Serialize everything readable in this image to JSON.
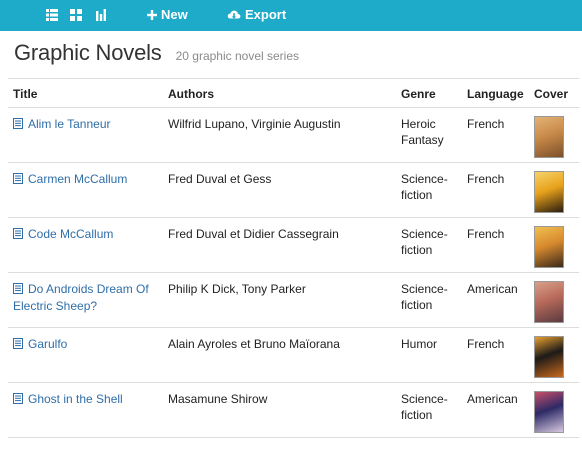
{
  "toolbar": {
    "view_icons": [
      "list-view-icon",
      "grid-view-icon",
      "chart-view-icon"
    ],
    "new_label": "New",
    "export_label": "Export",
    "accent_color": "#1eaac9"
  },
  "header": {
    "title": "Graphic Novels",
    "subtitle": "20 graphic novel series"
  },
  "table": {
    "columns": [
      "Title",
      "Authors",
      "Genre",
      "Language",
      "Cover"
    ],
    "rows": [
      {
        "title": "Alim le Tanneur",
        "authors": "Wilfrid Lupano, Virginie Augustin",
        "genre": "Heroic Fantasy",
        "language": "French",
        "cover_colors": [
          "#c98b4a",
          "#7d4f2a",
          "#e3b277"
        ]
      },
      {
        "title": "Carmen McCallum",
        "authors": "Fred Duval et Gess",
        "genre": "Science-fiction",
        "language": "French",
        "cover_colors": [
          "#e8a21c",
          "#2a1d10",
          "#f5d36a"
        ]
      },
      {
        "title": "Code McCallum",
        "authors": "Fred Duval et Didier Cassegrain",
        "genre": "Science-fiction",
        "language": "French",
        "cover_colors": [
          "#d88a2e",
          "#3b2a1c",
          "#f0c050"
        ]
      },
      {
        "title": "Do Androids Dream Of Electric Sheep?",
        "authors": "Philip K Dick, Tony Parker",
        "genre": "Science-fiction",
        "language": "American",
        "cover_colors": [
          "#b86a5a",
          "#5a3a40",
          "#d9a08a"
        ]
      },
      {
        "title": "Garulfo",
        "authors": "Alain Ayroles et Bruno Maïorana",
        "genre": "Humor",
        "language": "French",
        "cover_colors": [
          "#1c1a18",
          "#c96a1e",
          "#e8a030"
        ]
      },
      {
        "title": "Ghost in the Shell",
        "authors": "Masamune Shirow",
        "genre": "Science-fiction",
        "language": "American",
        "cover_colors": [
          "#2d2a66",
          "#d8c9e0",
          "#c94f6a"
        ]
      }
    ]
  }
}
